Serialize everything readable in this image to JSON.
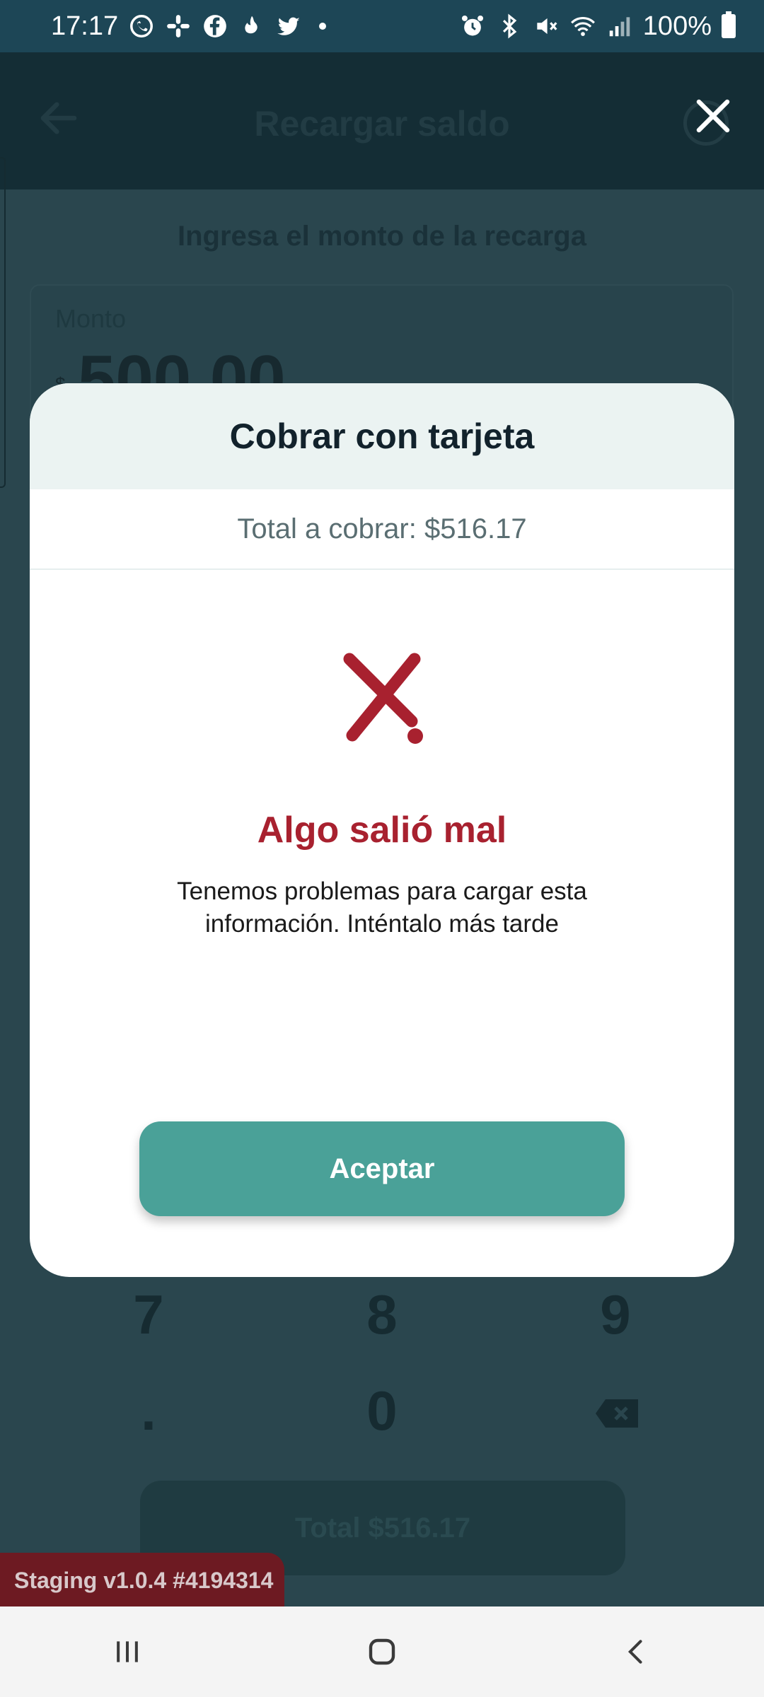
{
  "status_bar": {
    "time": "17:17",
    "battery": "100%",
    "left_icons": [
      "whatsapp-icon",
      "slack-icon",
      "facebook-icon",
      "notification-icon",
      "twitter-icon"
    ],
    "right_icons": [
      "alarm-icon",
      "bluetooth-icon",
      "mute-icon",
      "wifi-icon",
      "signal-icon",
      "battery-icon"
    ]
  },
  "app": {
    "title": "Recargar saldo",
    "amount_prompt": "Ingresa el monto de la recarga",
    "amount_label": "Monto",
    "amount_currency": "$",
    "amount_value": "500.00",
    "keypad": {
      "row_789": [
        "7",
        "8",
        "9"
      ],
      "decimal": ".",
      "zero": "0"
    },
    "total_button": "Total $516.17"
  },
  "modal": {
    "title": "Cobrar con tarjeta",
    "total": "Total a cobrar: $516.17",
    "error_title": "Algo salió mal",
    "error_message": "Tenemos problemas para cargar esta información. Inténtalo más tarde",
    "accept_button": "Aceptar"
  },
  "staging_badge": "Staging v1.0.4 #4194314",
  "colors": {
    "accent": "#4aa198",
    "error": "#a8212f",
    "status_bar": "#1d4656",
    "modal_header": "#ebf3f2"
  }
}
